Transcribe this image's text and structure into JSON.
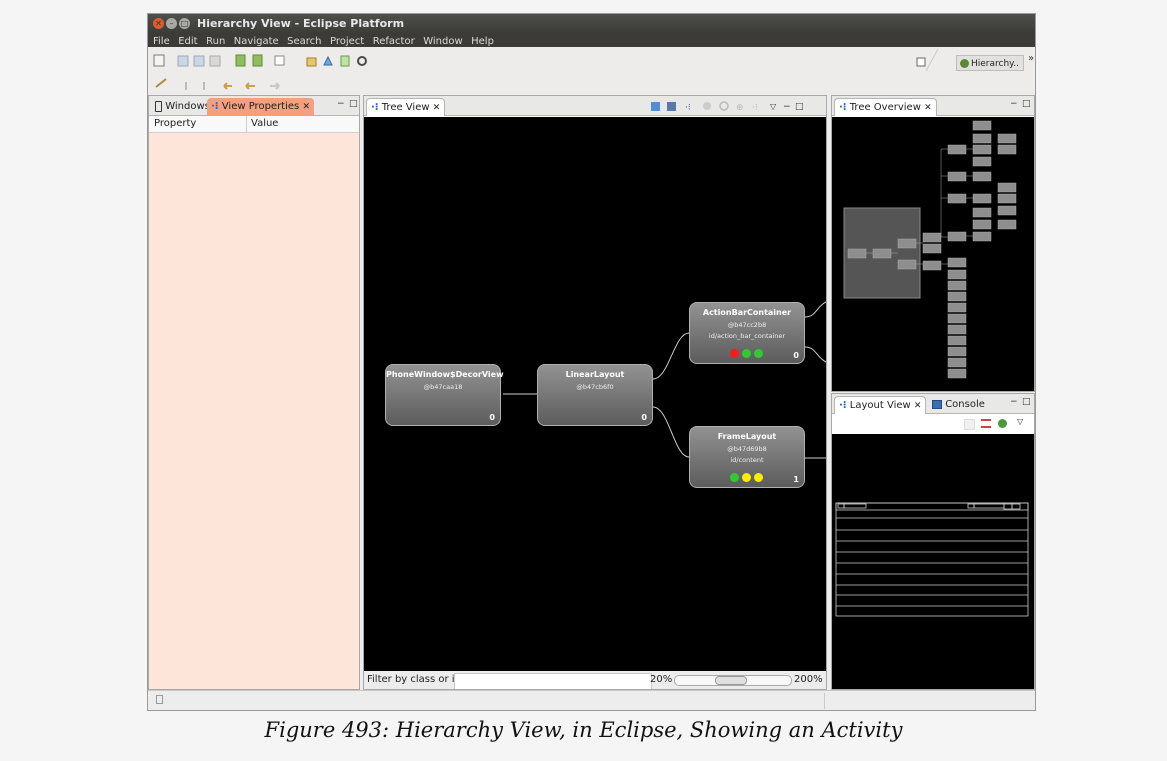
{
  "window": {
    "title": "Hierarchy View - Eclipse Platform",
    "close_glyph": "✕",
    "min_glyph": "–",
    "max_glyph": "□"
  },
  "menu": [
    "File",
    "Edit",
    "Run",
    "Navigate",
    "Search",
    "Project",
    "Refactor",
    "Window",
    "Help"
  ],
  "toolbar": {
    "perspective_label": "Hierarchy..",
    "overflow": "»"
  },
  "left_panel": {
    "tabs": [
      "Windows",
      "View Properties"
    ],
    "columns": [
      "Property",
      "Value"
    ]
  },
  "tree_view": {
    "tab": "Tree View",
    "nodes": [
      {
        "name": "PhoneWindow$DecorView",
        "id": "@b47caa18",
        "resource_id": "",
        "count": "0",
        "dots": []
      },
      {
        "name": "LinearLayout",
        "id": "@b47cb6f0",
        "resource_id": "",
        "count": "0",
        "dots": []
      },
      {
        "name": "ActionBarContainer",
        "id": "@b47cc2b8",
        "resource_id": "id/action_bar_container",
        "count": "0",
        "dots": [
          "#ff1a1a",
          "#2ecc2e",
          "#2ecc2e"
        ]
      },
      {
        "name": "FrameLayout",
        "id": "@b47d69b8",
        "resource_id": "id/content",
        "count": "1",
        "dots": [
          "#2ecc2e",
          "#ffee00",
          "#ffee00"
        ]
      }
    ],
    "filter_label": "Filter by class or id:",
    "filter_value": "",
    "zoom_min": "20%",
    "zoom_max": "200%"
  },
  "tree_overview": {
    "tab": "Tree Overview"
  },
  "layout_panel": {
    "tabs": [
      "Layout View",
      "Console"
    ]
  },
  "caption": "Figure 493: Hierarchy View, in Eclipse, Showing an Activity"
}
